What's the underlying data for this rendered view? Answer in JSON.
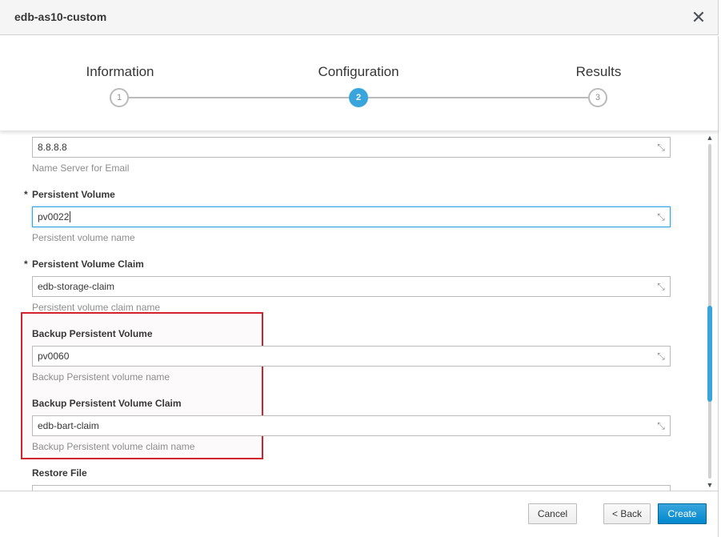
{
  "modal": {
    "title": "edb-as10-custom",
    "close_glyph": "✕"
  },
  "wizard": {
    "steps": [
      {
        "label": "Information",
        "number": "1",
        "active": false
      },
      {
        "label": "Configuration",
        "number": "2",
        "active": true
      },
      {
        "label": "Results",
        "number": "3",
        "active": false
      }
    ]
  },
  "form": {
    "name_server": {
      "value": "8.8.8.8",
      "help": "Name Server for Email"
    },
    "persistent_volume": {
      "required_mark": "*",
      "label": "Persistent Volume",
      "value": "pv0022",
      "help": "Persistent volume name"
    },
    "persistent_volume_claim": {
      "required_mark": "*",
      "label": "Persistent Volume Claim",
      "value": "edb-storage-claim",
      "help": "Persistent volume claim name"
    },
    "backup_persistent_volume": {
      "label": "Backup Persistent Volume",
      "value": "pv0060",
      "help": "Backup Persistent volume name"
    },
    "backup_persistent_volume_claim": {
      "label": "Backup Persistent Volume Claim",
      "value": "edb-bart-claim",
      "help": "Backup Persistent volume claim name"
    },
    "restore_file": {
      "label": "Restore File",
      "value": ""
    }
  },
  "icons": {
    "resize": "resize-handle-icon",
    "scroll_up": "▲",
    "scroll_down": "▼"
  },
  "colors": {
    "accent": "#39a5dc",
    "highlight_border": "#d2222d"
  },
  "footer": {
    "cancel_label": "Cancel",
    "back_label": "< Back",
    "create_label": "Create"
  }
}
